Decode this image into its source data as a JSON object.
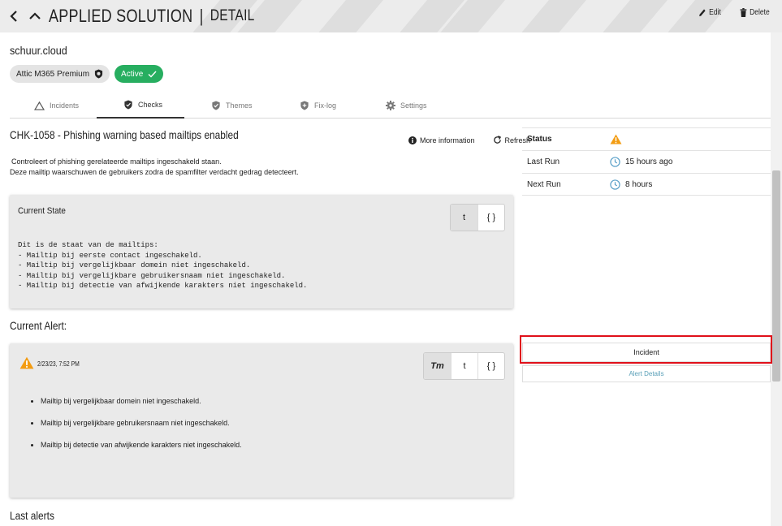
{
  "header": {
    "title": "APPLIED SOLUTION",
    "separator": "|",
    "subtitle": "DETAIL",
    "edit_label": "Edit",
    "delete_label": "Delete"
  },
  "site_name": "schuur.cloud",
  "badges": {
    "plan": "Attic M365 Premium",
    "status": "Active"
  },
  "tabs": [
    {
      "label": "Incidents",
      "icon": "warning-outline-icon"
    },
    {
      "label": "Checks",
      "icon": "shield-check-icon"
    },
    {
      "label": "Themes",
      "icon": "shield-check-icon"
    },
    {
      "label": "Fix-log",
      "icon": "shield-plus-icon"
    },
    {
      "label": "Settings",
      "icon": "gear-icon"
    }
  ],
  "check": {
    "title": "CHK-1058 - Phishing warning based mailtips enabled",
    "more_info_label": "More information",
    "refresh_label": "Refresh",
    "description_line1": "Controleert of phishing gerelateerde mailtips ingeschakeld staan.",
    "description_line2": "Deze mailtip waarschuwen de gebruikers zodra de spamfilter verdacht gedrag detecteert."
  },
  "status": {
    "status_label": "Status",
    "last_run_label": "Last Run",
    "last_run_value": "15 hours ago",
    "next_run_label": "Next Run",
    "next_run_value": "8 hours",
    "warning_color": "#f39c12"
  },
  "current_state": {
    "title": "Current State",
    "toggle_text": "t",
    "toggle_json": "{ }",
    "content": "Dit is de staat van de mailtips:\n- Mailtip bij eerste contact ingeschakeld.\n- Mailtip bij vergelijkbaar domein niet ingeschakeld.\n- Mailtip bij vergelijkbare gebruikersnaam niet ingeschakeld.\n- Mailtip bij detectie van afwijkende karakters niet ingeschakeld."
  },
  "current_alert": {
    "section_title": "Current Alert:",
    "date": "2/23/23, 7:52 PM",
    "toggle_rich": "Tт",
    "toggle_text": "t",
    "toggle_json": "{ }",
    "items": [
      "Mailtip bij vergelijkbaar domein niet ingeschakeld.",
      "Mailtip bij vergelijkbare gebruikersnaam niet ingeschakeld.",
      "Mailtip bij detectie van afwijkende karakters niet ingeschakeld."
    ]
  },
  "actions": {
    "incident_label": "Incident",
    "alert_details_label": "Alert Details"
  },
  "last_alerts_title": "Last alerts",
  "colors": {
    "active_green": "#27ae60",
    "highlight_red": "#e0101a",
    "link_blue": "#5aa0b8"
  }
}
